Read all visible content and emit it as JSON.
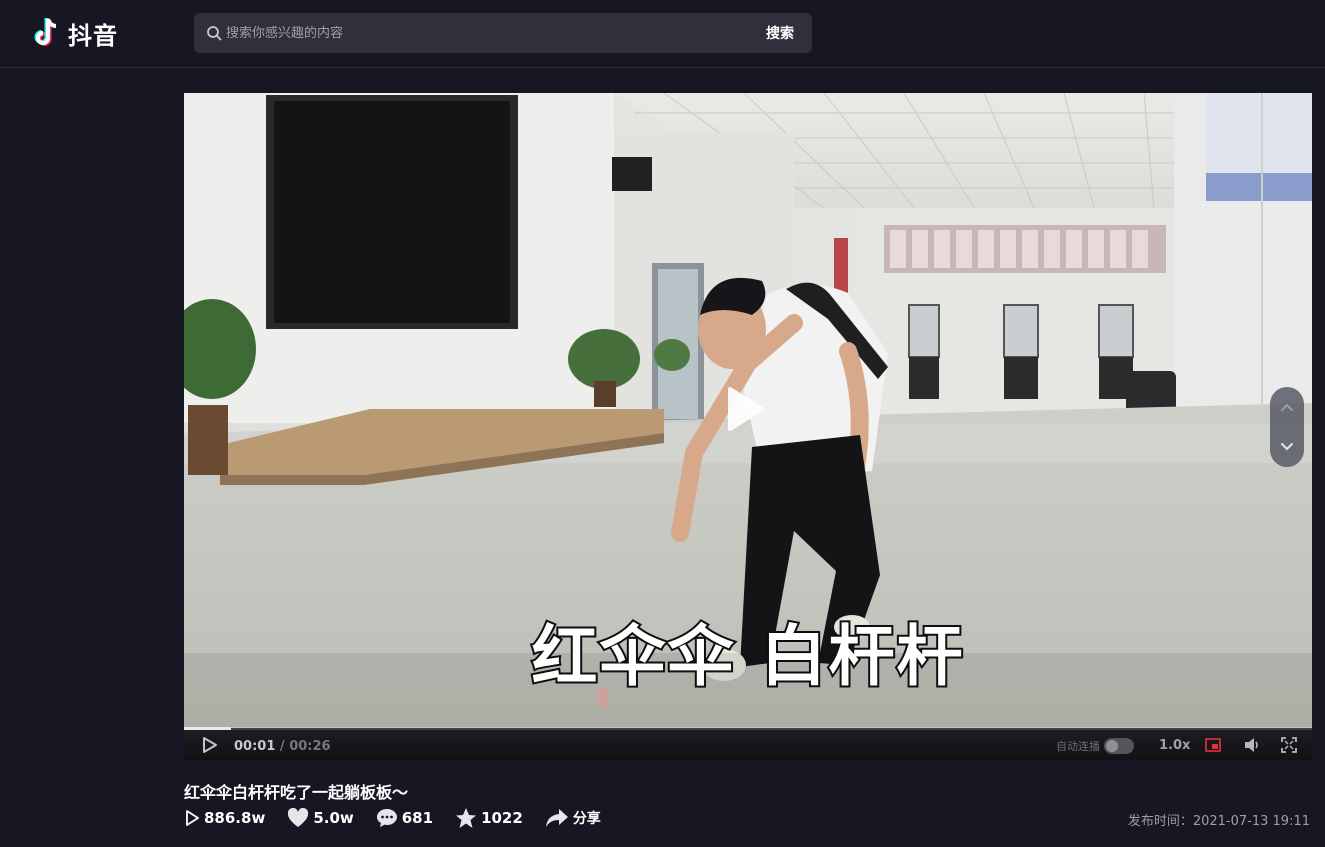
{
  "app": {
    "name": "抖音"
  },
  "search": {
    "placeholder": "搜索你感兴趣的内容",
    "button_label": "搜索"
  },
  "player": {
    "subtitle": "红伞伞 白杆杆",
    "current_time": "00:01",
    "separator": "/",
    "duration": "00:26",
    "progress_fraction": 0.042,
    "autoplay_label": "自动连播",
    "autoplay_on": false,
    "speed_label": "1.0x"
  },
  "video": {
    "title": "红伞伞白杆杆吃了一起躺板板～",
    "plays": "886.8w",
    "likes": "5.0w",
    "comments": "681",
    "favorites": "1022",
    "share_label": "分享",
    "publish_label": "发布时间：",
    "publish_time": "2021-07-13 19:11"
  },
  "colors": {
    "background": "#161722",
    "search_bg": "#2f303c",
    "pip_accent": "#e0323c"
  }
}
